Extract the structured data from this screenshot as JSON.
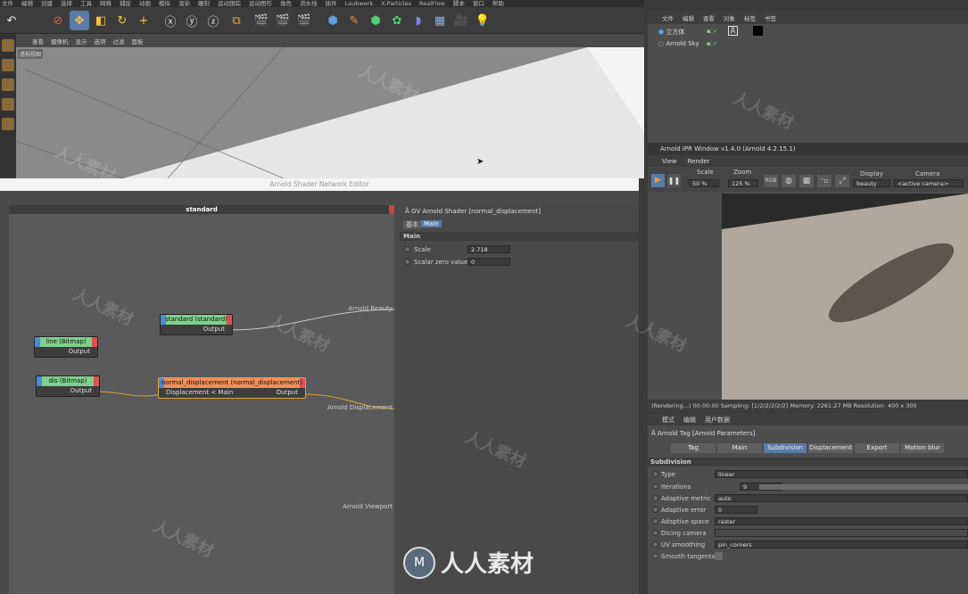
{
  "menubar": [
    "文件",
    "编辑",
    "创建",
    "选择",
    "工具",
    "网格",
    "捕捉",
    "动画",
    "模拟",
    "渲染",
    "雕刻",
    "运动跟踪",
    "运动图形",
    "角色",
    "流水线",
    "插件",
    "Laubwerk",
    "X-Particles",
    "RealFlow",
    "脚本",
    "窗口",
    "帮助"
  ],
  "viewport": {
    "menu": [
      "查看",
      "摄像机",
      "显示",
      "选项",
      "过滤",
      "面板"
    ],
    "label": "透视视图"
  },
  "shader_editor": {
    "title": "Arnold Shader Network Editor",
    "graph_title": "standard",
    "nodes": {
      "standard": {
        "title": "standard (standard)",
        "port": "Output"
      },
      "line": {
        "title": "line (Bitmap)",
        "port": "Output"
      },
      "dis": {
        "title": "dis (Bitmap)",
        "port": "Output"
      },
      "normal_displacement": {
        "title": "normal_displacement (normal_displacement)",
        "in_port": "Displacement < Main",
        "out_port": "Output"
      }
    },
    "outputs": {
      "beauty": "Arnold Beauty",
      "displacement": "Arnold Displacement",
      "viewport": "Arnold Viewport"
    },
    "attr": {
      "header": "GV Arnold Shader [normal_displacement]",
      "tabs": [
        "基本",
        "Main"
      ],
      "section": "Main",
      "fields": [
        {
          "label": "Scale",
          "value": "2.718"
        },
        {
          "label": "Scalar zero value",
          "value": "0"
        }
      ]
    }
  },
  "object_manager": {
    "menu": [
      "文件",
      "编辑",
      "查看",
      "对象",
      "标签",
      "书签"
    ],
    "objects": [
      "立方体",
      "Arnold Sky"
    ]
  },
  "ipr": {
    "title": "Arnold IPR Window v1.4.0 (Arnold 4.2.15.1)",
    "menu": [
      "View",
      "Render"
    ],
    "scale_label": "Scale",
    "scale_value": "50 %",
    "zoom_label": "Zoom",
    "zoom_value": "125 %",
    "rgb": "RGB",
    "display_label": "Display",
    "display_value": "beauty",
    "camera_label": "Camera",
    "camera_value": "<active camera>",
    "status": "(Rendering...)  00:00:00  Sampling: [1/2/2/2/2/2]  Memory: 2261.27 MB  Resolution: 400 x 300"
  },
  "attribute_manager": {
    "menu": [
      "模式",
      "编辑",
      "用户数据"
    ],
    "tag_title": "Arnold Tag [Arnold Parameters]",
    "tabs": [
      "Tag",
      "Main",
      "Subdivision",
      "Displacement",
      "Export",
      "Motion blur"
    ],
    "active_tab": "Subdivision",
    "section": "Subdivision",
    "fields": [
      {
        "label": "Type",
        "value": "linear"
      },
      {
        "label": "Iterations",
        "value": "9"
      },
      {
        "label": "Adaptive metric",
        "value": "auto"
      },
      {
        "label": "Adaptive error",
        "value": "0"
      },
      {
        "label": "Adaptive space",
        "value": "raster"
      },
      {
        "label": "Dicing camera",
        "value": ""
      },
      {
        "label": "UV smoothing",
        "value": "pin_corners"
      },
      {
        "label": "Smooth tangents",
        "value": ""
      }
    ]
  },
  "watermark": "人人素材",
  "colors": {
    "accent": "#5a7aa8",
    "wire_orange": "#e0a030",
    "node_green": "#7ed08a",
    "node_red": "#e05050",
    "node_orange": "#f0905a"
  }
}
